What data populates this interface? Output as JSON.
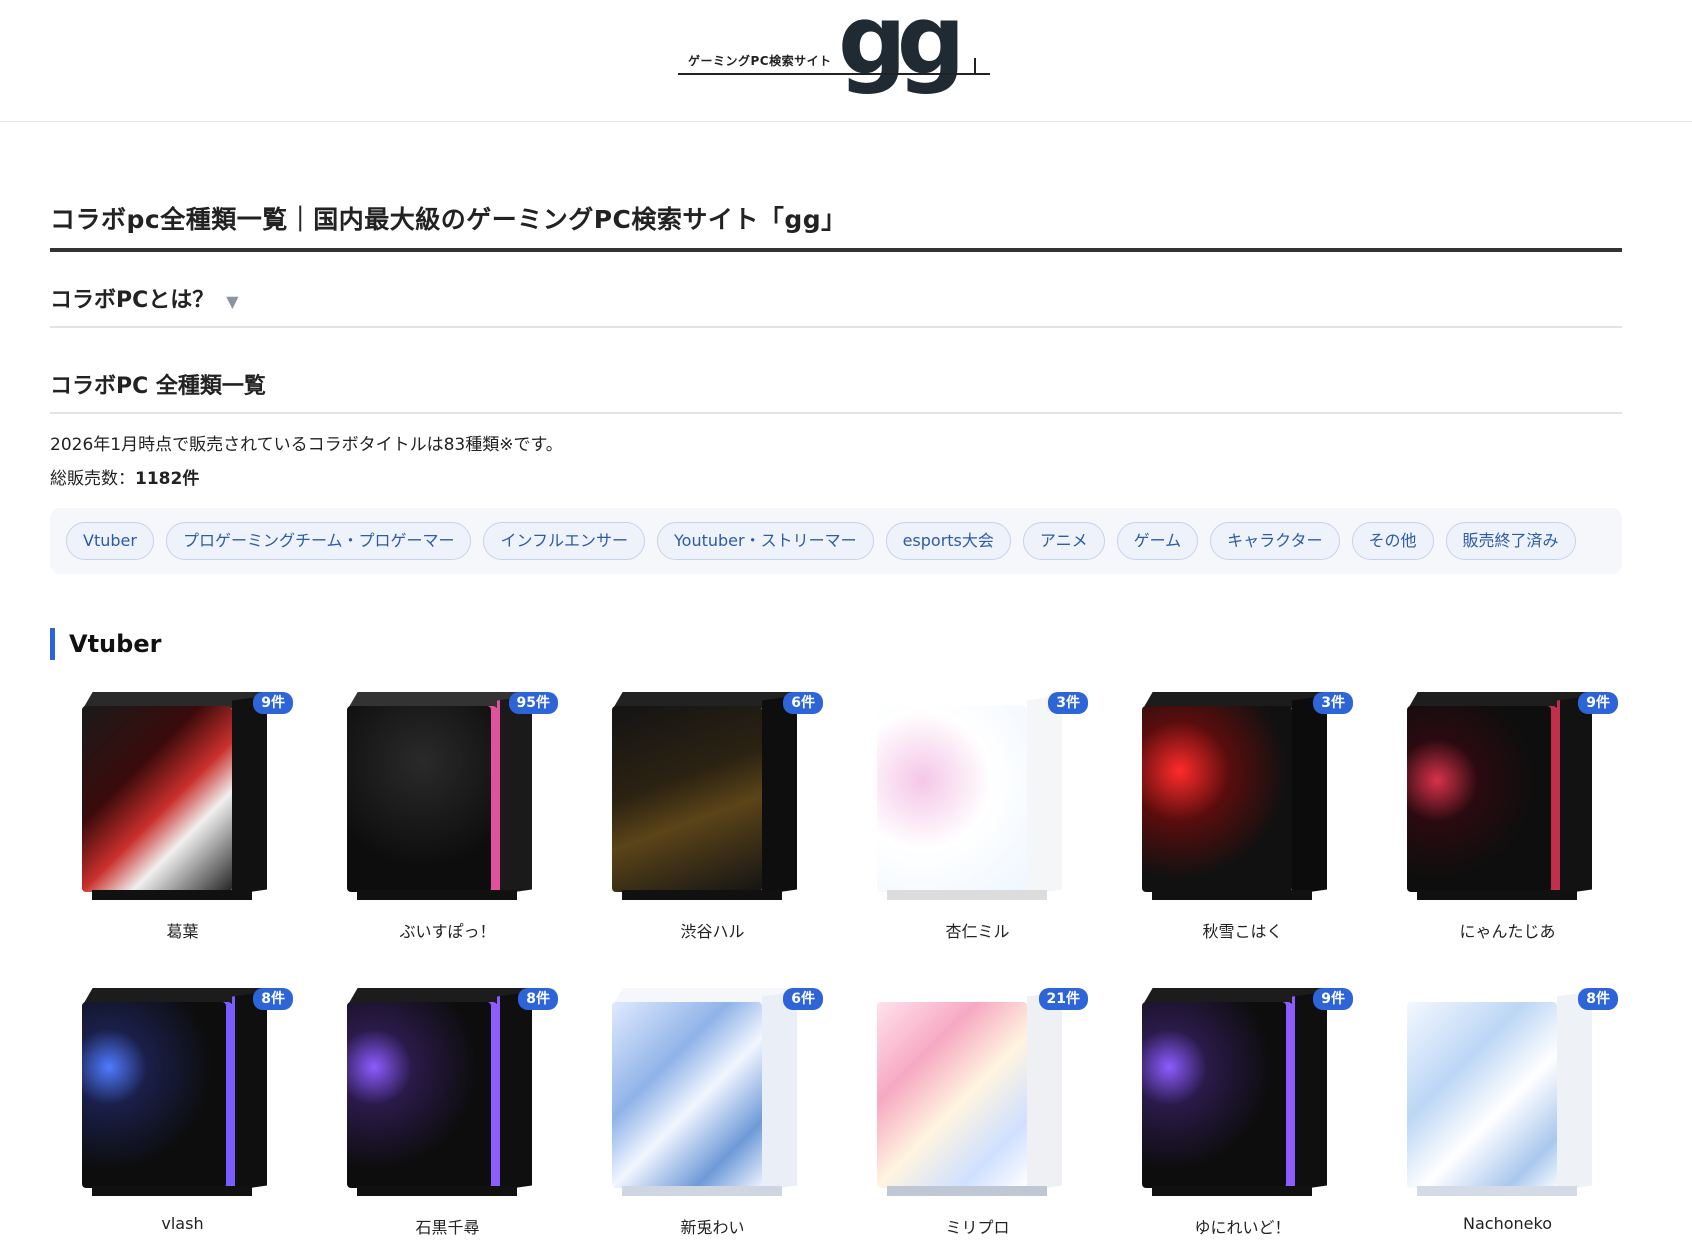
{
  "logo": {
    "tagline": "ゲーミングPC検索サイト",
    "mark": "gg"
  },
  "page_title": "コラボpc全種類一覧｜国内最大級のゲーミングPC検索サイト「gg」",
  "accordion": {
    "title": "コラボPCとは？",
    "caret": "▼"
  },
  "section_title": "コラボPC 全種類一覧",
  "summary": {
    "line1": "2026年1月時点で販売されているコラボタイトルは83種類※です。",
    "total_label": "総販売数：",
    "total_value": "1182件"
  },
  "filters": [
    "Vtuber",
    "プロゲーミングチーム・プロゲーマー",
    "インフルエンサー",
    "Youtuber・ストリーマー",
    "esports大会",
    "アニメ",
    "ゲーム",
    "キャラクター",
    "その他",
    "販売終了済み"
  ],
  "category": {
    "title": "Vtuber"
  },
  "products": [
    {
      "name": "葛葉",
      "count": "9件",
      "style": "dark-red"
    },
    {
      "name": "ぶいすぽっ！",
      "count": "95件",
      "style": "dark-pink"
    },
    {
      "name": "渋谷ハル",
      "count": "6件",
      "style": "dark-gold"
    },
    {
      "name": "杏仁ミル",
      "count": "3件",
      "style": "white-pink"
    },
    {
      "name": "秋雪こはく",
      "count": "3件",
      "style": "dark-red-fans"
    },
    {
      "name": "にゃんたじあ",
      "count": "9件",
      "style": "dark-redstripe"
    },
    {
      "name": "vlash",
      "count": "8件",
      "style": "dark-rgb"
    },
    {
      "name": "石黒千尋",
      "count": "8件",
      "style": "dark-purple"
    },
    {
      "name": "新兎わい",
      "count": "6件",
      "style": "white-blue"
    },
    {
      "name": "ミリプロ",
      "count": "21件",
      "style": "white-pinkart"
    },
    {
      "name": "ゆにれいど！",
      "count": "9件",
      "style": "dark-purple"
    },
    {
      "name": "Nachoneko",
      "count": "8件",
      "style": "white-lightblue"
    }
  ],
  "colors": {
    "accent": "#2d64d8",
    "chip_bg": "#eef3fb",
    "chip_border": "#c5d3ea",
    "chip_text": "#2e5aa8",
    "filter_bar_bg": "#f5f7fa"
  }
}
